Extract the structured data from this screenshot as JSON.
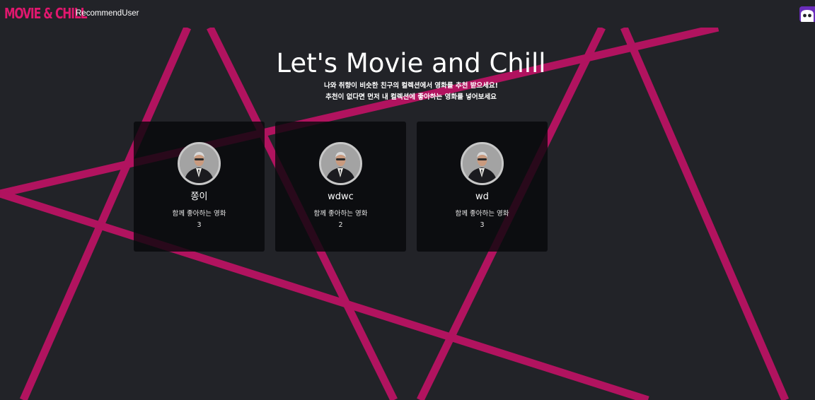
{
  "theme": {
    "background": "#222328",
    "accent": "#b1135f",
    "brand_color": "#e0176e",
    "card_background": "#0a0a0c",
    "profile_icon_color": "#6a2dbb"
  },
  "navbar": {
    "brand": "MOVIE & CHILL",
    "link": "RecommendUser",
    "profile_icon": "ghost-avatar-icon"
  },
  "hero": {
    "title": "Let's Movie and Chill",
    "subtitle_line1": "나와 취향이 비슷한 친구의 컬렉션에서 영화를 추천 받으세요!",
    "subtitle_line2": "추천이 없다면 먼저 내 컬렉션에 좋아하는 영화를 넣어보세요"
  },
  "users": [
    {
      "name": "쫑이",
      "label": "함께 좋아하는 영화",
      "count": "3",
      "avatar": "user-avatar-icon"
    },
    {
      "name": "wdwc",
      "label": "함께 좋아하는 영화",
      "count": "2",
      "avatar": "user-avatar-icon"
    },
    {
      "name": "wd",
      "label": "함께 좋아하는 영화",
      "count": "3",
      "avatar": "user-avatar-icon"
    }
  ]
}
